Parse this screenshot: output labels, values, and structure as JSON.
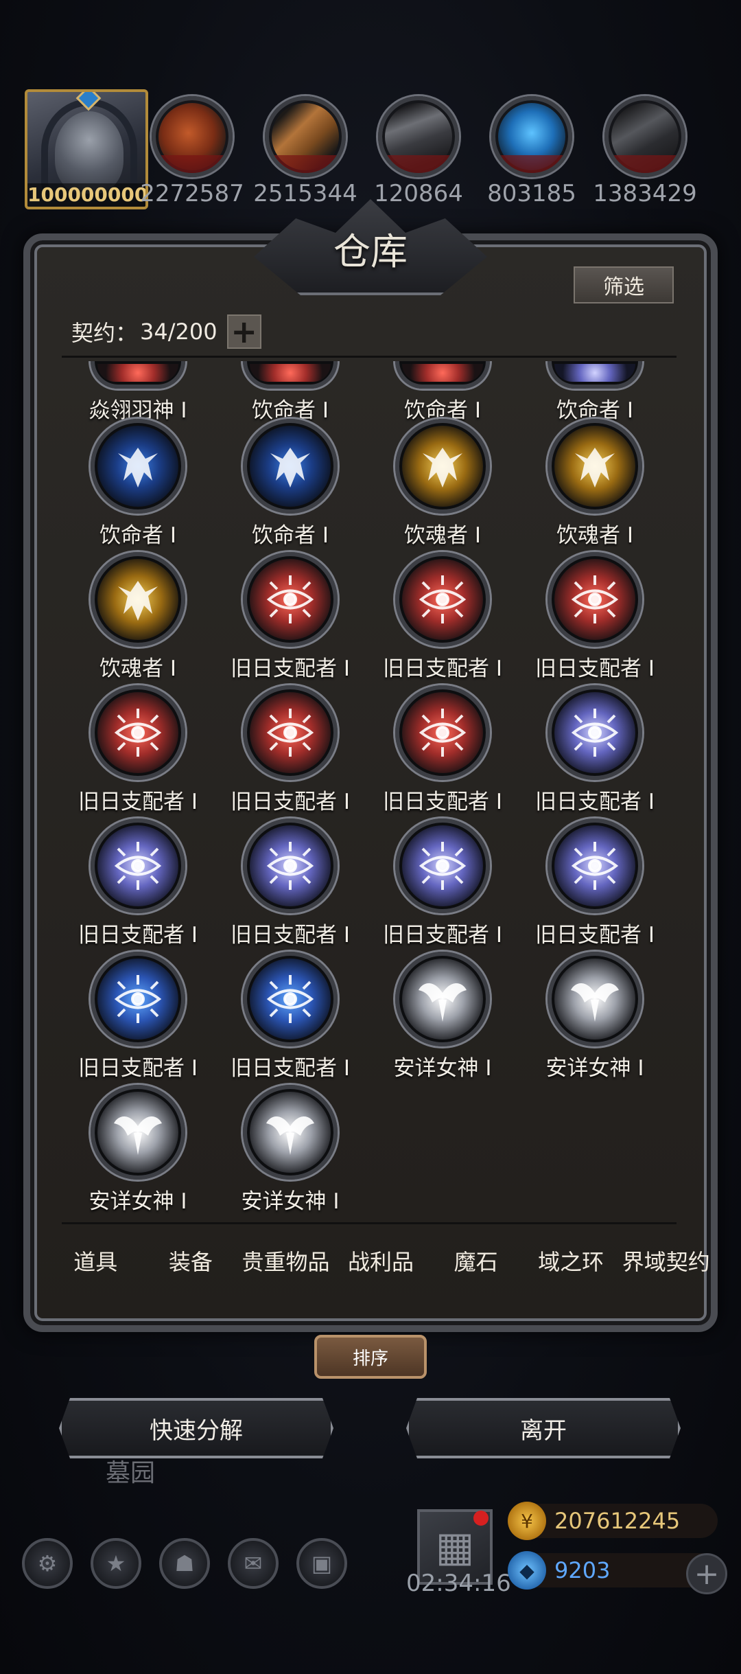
{
  "top": {
    "avatar_amount": "100000000",
    "resources": [
      {
        "name": "meat",
        "value": "2272587"
      },
      {
        "name": "wood",
        "value": "2515344"
      },
      {
        "name": "iron",
        "value": "120864"
      },
      {
        "name": "crystal",
        "value": "803185"
      },
      {
        "name": "stone",
        "value": "1383429"
      }
    ]
  },
  "panel": {
    "title": "仓库",
    "filter_label": "筛选",
    "contract_label": "契约：",
    "contract_value": "34/200",
    "plus_label": "+"
  },
  "items": [
    {
      "name": "焱翎羽神 I",
      "theme": "t-red",
      "glyph": "wing",
      "partial": true
    },
    {
      "name": "饮命者 I",
      "theme": "t-red",
      "glyph": "claw",
      "partial": true
    },
    {
      "name": "饮命者 I",
      "theme": "t-red",
      "glyph": "claw",
      "partial": true
    },
    {
      "name": "饮命者 I",
      "theme": "t-violet",
      "glyph": "claw",
      "partial": true
    },
    {
      "name": "饮命者 I",
      "theme": "t-blue",
      "glyph": "claw"
    },
    {
      "name": "饮命者 I",
      "theme": "t-blue",
      "glyph": "claw"
    },
    {
      "name": "饮魂者 I",
      "theme": "t-gold",
      "glyph": "claw"
    },
    {
      "name": "饮魂者 I",
      "theme": "t-gold",
      "glyph": "claw"
    },
    {
      "name": "饮魂者 I",
      "theme": "t-gold",
      "glyph": "claw"
    },
    {
      "name": "旧日支配者 I",
      "theme": "t-red",
      "glyph": "eye"
    },
    {
      "name": "旧日支配者 I",
      "theme": "t-red",
      "glyph": "eye"
    },
    {
      "name": "旧日支配者 I",
      "theme": "t-red",
      "glyph": "eye"
    },
    {
      "name": "旧日支配者 I",
      "theme": "t-red",
      "glyph": "eye"
    },
    {
      "name": "旧日支配者 I",
      "theme": "t-red",
      "glyph": "eye"
    },
    {
      "name": "旧日支配者 I",
      "theme": "t-red",
      "glyph": "eye"
    },
    {
      "name": "旧日支配者 I",
      "theme": "t-violet",
      "glyph": "eye"
    },
    {
      "name": "旧日支配者 I",
      "theme": "t-violet",
      "glyph": "eye"
    },
    {
      "name": "旧日支配者 I",
      "theme": "t-violet",
      "glyph": "eye"
    },
    {
      "name": "旧日支配者 I",
      "theme": "t-violet",
      "glyph": "eye"
    },
    {
      "name": "旧日支配者 I",
      "theme": "t-violet",
      "glyph": "eye"
    },
    {
      "name": "旧日支配者 I",
      "theme": "t-azure",
      "glyph": "eye"
    },
    {
      "name": "旧日支配者 I",
      "theme": "t-azure",
      "glyph": "eye"
    },
    {
      "name": "安详女神 I",
      "theme": "t-silver",
      "glyph": "wing"
    },
    {
      "name": "安详女神 I",
      "theme": "t-silver",
      "glyph": "wing"
    },
    {
      "name": "安详女神 I",
      "theme": "t-silver",
      "glyph": "wing"
    },
    {
      "name": "安详女神 I",
      "theme": "t-silver",
      "glyph": "wing"
    }
  ],
  "tabs": [
    "道具",
    "装备",
    "贵重物品",
    "战利品",
    "魔石",
    "域之环",
    "界域契约"
  ],
  "sort_label": "排序",
  "actions": {
    "quick_decompose": "快速分解",
    "leave": "离开"
  },
  "background_label": "墓园",
  "hud": {
    "timer": "02:34:16",
    "gold": "207612245",
    "diamond": "9203",
    "add": "+"
  },
  "colors": {
    "gold_text": "#e7c77a",
    "diamond_text": "#5fa8ff",
    "panel_border": "#4a4c52"
  }
}
